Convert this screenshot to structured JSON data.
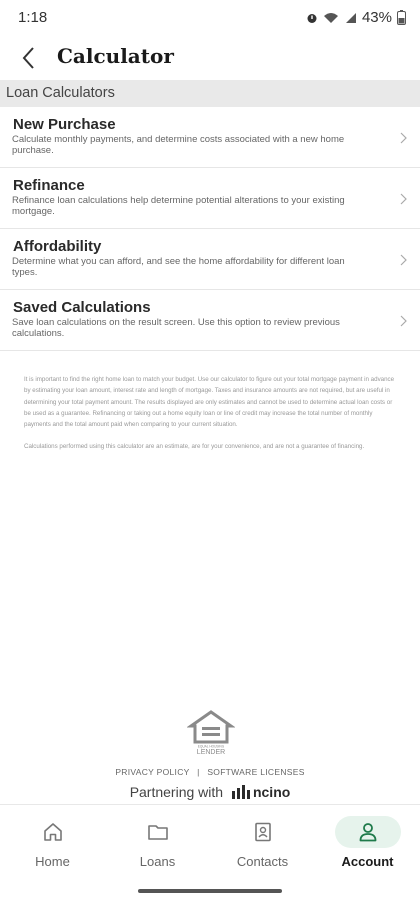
{
  "status": {
    "time": "1:18",
    "battery": "43%"
  },
  "header": {
    "title": "Calculator"
  },
  "section": {
    "title": "Loan Calculators"
  },
  "calculators": [
    {
      "title": "New Purchase",
      "description": "Calculate monthly payments, and determine costs associated with a new home purchase."
    },
    {
      "title": "Refinance",
      "description": "Refinance loan calculations help determine potential alterations to your existing mortgage."
    },
    {
      "title": "Affordability",
      "description": "Determine what you can afford, and see the home affordability for different loan types."
    },
    {
      "title": "Saved Calculations",
      "description": "Save loan calculations on the result screen. Use this option to review previous calculations."
    }
  ],
  "disclaimer": {
    "p1": "It is important to find the right home loan to match your budget. Use our calculator to figure out your total mortgage payment in advance by estimating your loan amount, interest rate and length of mortgage. Taxes and insurance amounts are not required, but are useful in determining your total payment amount. The results displayed are only estimates and cannot be used to determine actual loan costs or be used as a guarantee. Refinancing or taking out a home equity loan or line of credit may increase the total number of monthly payments and the total amount paid when comparing to your current situation.",
    "p2": "Calculations performed using this calculator are an estimate, are for your convenience, and are not a guarantee of financing."
  },
  "footer": {
    "logo_text": "EQUAL HOUSING LENDER",
    "privacy": "PRIVACY POLICY",
    "separator": "|",
    "licenses": "SOFTWARE LICENSES",
    "partner_prefix": "Partnering with",
    "partner_name": "ncino"
  },
  "nav": {
    "items": [
      {
        "label": "Home",
        "icon": "home-icon"
      },
      {
        "label": "Loans",
        "icon": "folder-icon"
      },
      {
        "label": "Contacts",
        "icon": "contact-card-icon"
      },
      {
        "label": "Account",
        "icon": "person-icon",
        "active": true
      }
    ]
  },
  "colors": {
    "accent": "#1e7a4a",
    "active_pill": "#e6f3ec"
  }
}
